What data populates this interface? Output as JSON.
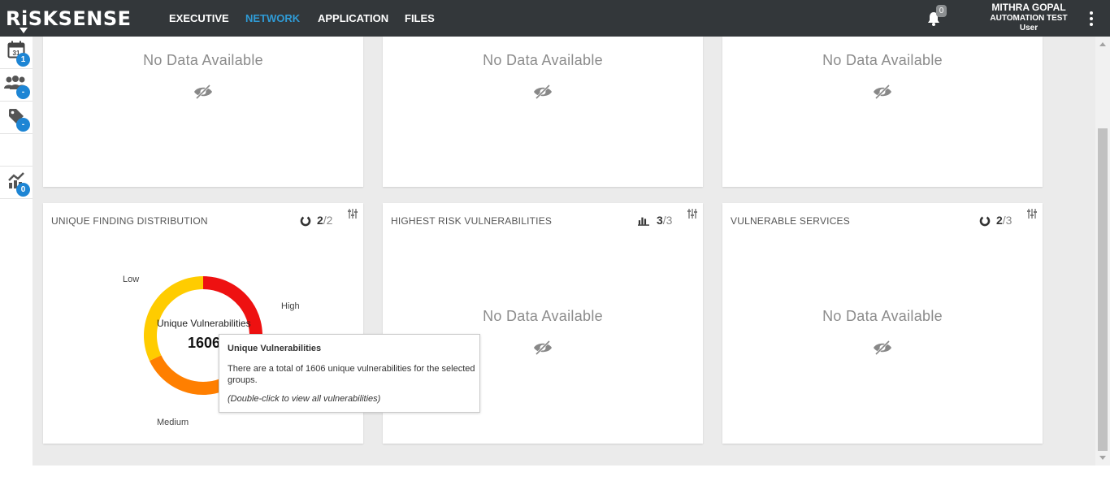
{
  "header": {
    "logo_text": "RiSKSENSE",
    "nav": [
      {
        "label": "EXECUTIVE",
        "active": false
      },
      {
        "label": "NETWORK",
        "active": true
      },
      {
        "label": "APPLICATION",
        "active": false
      },
      {
        "label": "FILES",
        "active": false
      }
    ],
    "notifications_count": "0",
    "user": {
      "name": "MITHRA GOPAL",
      "org": "AUTOMATION TEST",
      "role": "User"
    },
    "accent_color": "#2f9bd6"
  },
  "sidebar": {
    "items": [
      {
        "icon": "calendar-icon",
        "icon_text": "31",
        "badge": "1"
      },
      {
        "icon": "groups-icon",
        "badge": "-"
      },
      {
        "icon": "tag-icon",
        "badge": "-"
      },
      {
        "icon": "trend-chart-icon",
        "badge": "0"
      }
    ]
  },
  "top_cards": [
    {
      "message": "No Data Available"
    },
    {
      "message": "No Data Available"
    },
    {
      "message": "No Data Available"
    }
  ],
  "cards": [
    {
      "title": "UNIQUE FINDING DISTRIBUTION",
      "count_icon": "donut-icon",
      "count_current": "2",
      "count_total": "/2",
      "center_label": "Unique Vulnerabilities",
      "center_value": "1606",
      "segment_labels": {
        "low": "Low",
        "high": "High",
        "medium": "Medium"
      }
    },
    {
      "title": "HIGHEST RISK VULNERABILITIES",
      "count_icon": "bar-chart-icon",
      "count_current": "3",
      "count_total": "/3",
      "message": "No Data Available"
    },
    {
      "title": "VULNERABLE SERVICES",
      "count_icon": "donut-icon",
      "count_current": "2",
      "count_total": "/3",
      "message": "No Data Available"
    }
  ],
  "chart_data": {
    "type": "pie",
    "series": [
      {
        "categories": [
          "High",
          "Medium",
          "Low"
        ],
        "values": [
          0.28,
          0.4,
          0.32
        ],
        "colors": [
          "#ee1111",
          "#ff7f00",
          "#ffcc00"
        ]
      }
    ],
    "center_label": "Unique Vulnerabilities",
    "center_value": 1606
  },
  "tooltip": {
    "title": "Unique Vulnerabilities",
    "body": "There are a total of 1606 unique vulnerabilities for the selected groups.",
    "hint": "(Double-click to view all vulnerabilities)"
  }
}
